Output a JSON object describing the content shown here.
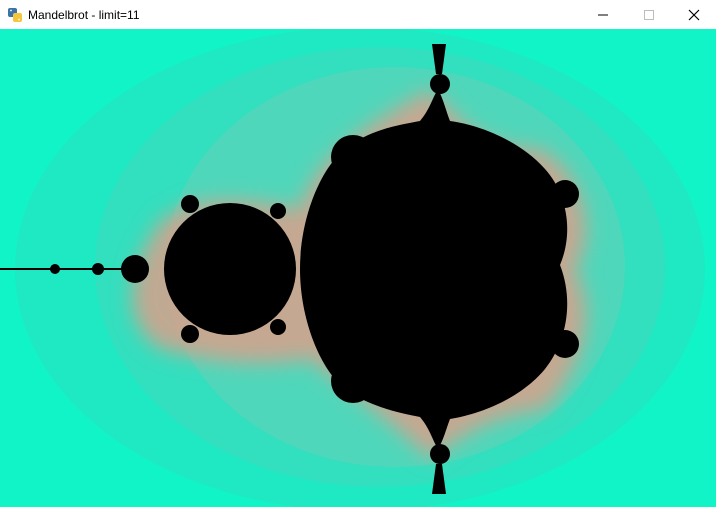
{
  "window": {
    "title": "Mandelbrot - limit=11",
    "icon": "python-icon"
  },
  "caption_buttons": {
    "minimize_icon": "minimize-icon",
    "maximize_icon": "maximize-icon",
    "close_icon": "close-icon"
  },
  "canvas": {
    "set_color": "#000000",
    "background_color": "#10f4c8",
    "edge_color": "#e09a86"
  }
}
